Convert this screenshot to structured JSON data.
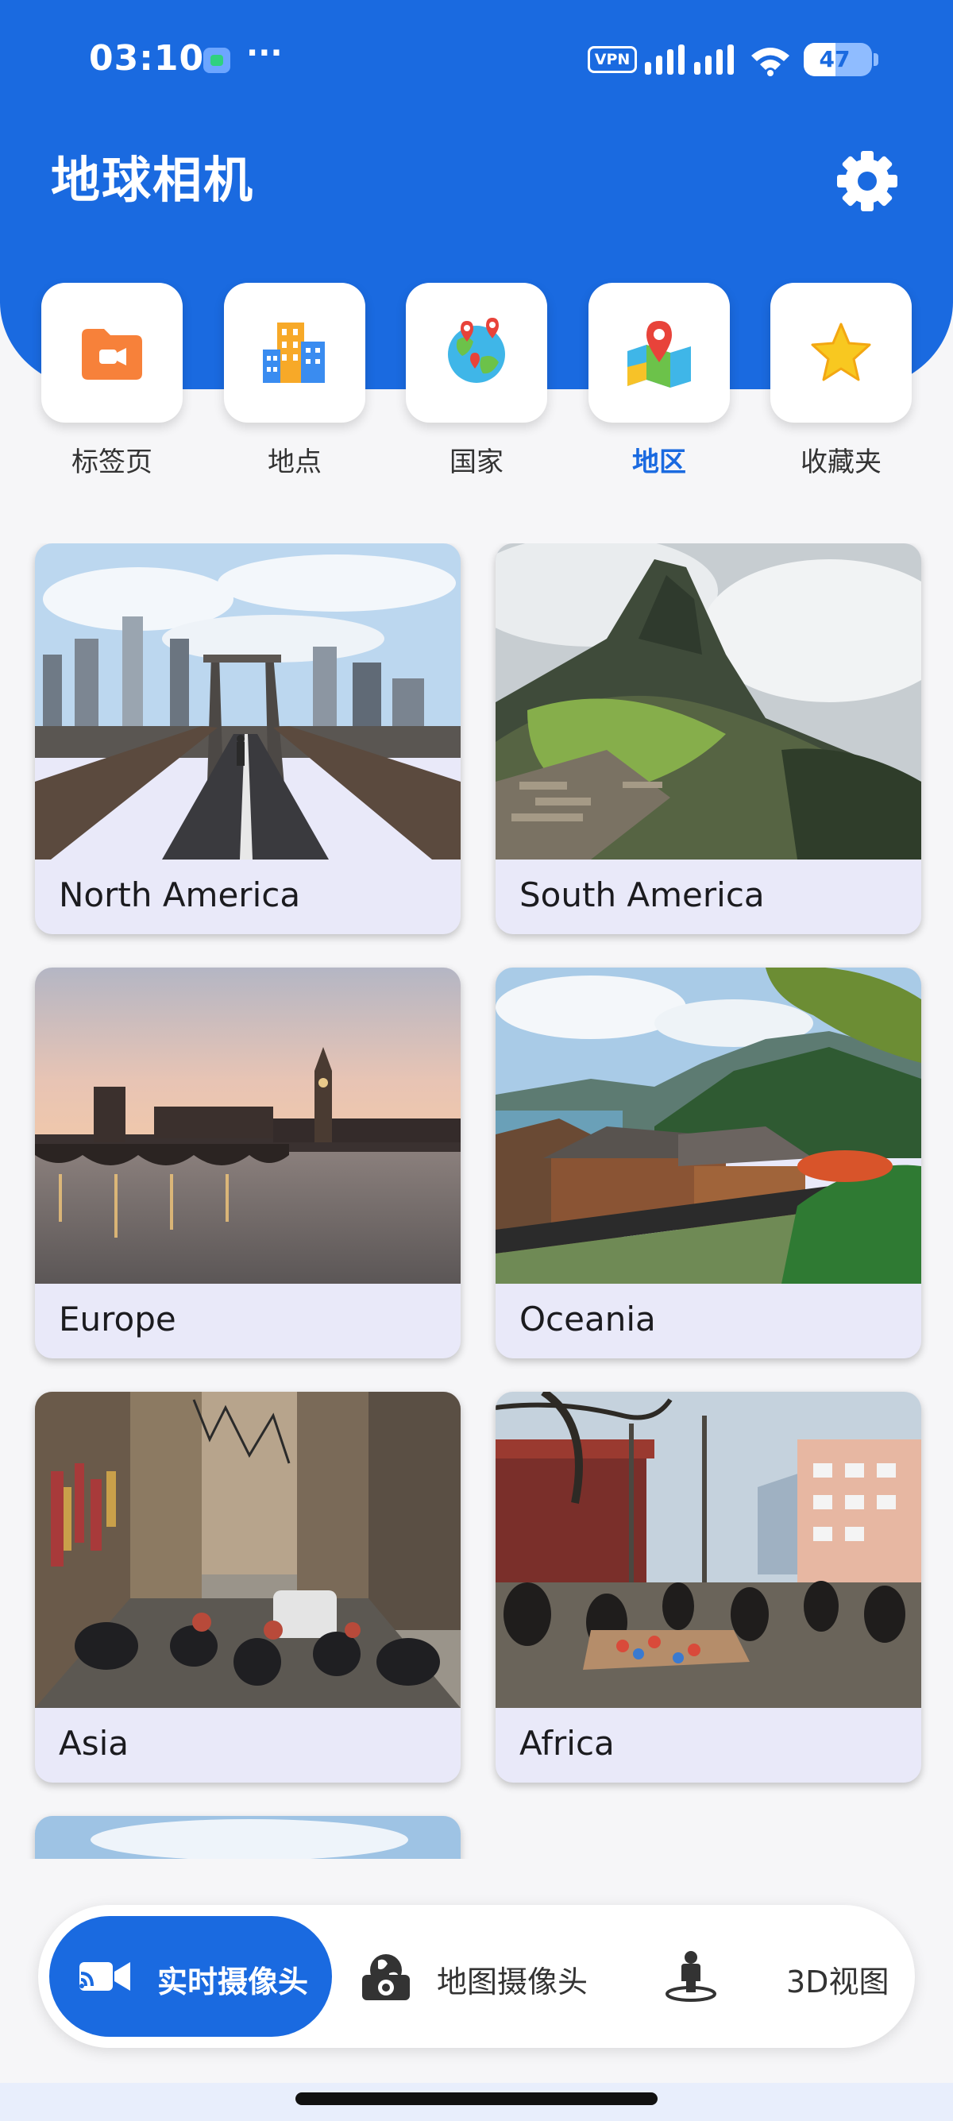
{
  "status_bar": {
    "time": "03:10",
    "dots": "···",
    "vpn": "VPN",
    "battery_level": "47",
    "battery_fraction": 0.47
  },
  "header": {
    "title": "地球相机",
    "settings_icon": "gear-icon"
  },
  "categories": [
    {
      "label": "标签页",
      "icon": "tag-folder-icon",
      "active": false
    },
    {
      "label": "地点",
      "icon": "buildings-icon",
      "active": false
    },
    {
      "label": "国家",
      "icon": "globe-pins-icon",
      "active": false
    },
    {
      "label": "地区",
      "icon": "map-pin-icon",
      "active": true
    },
    {
      "label": "收藏夹",
      "icon": "star-icon",
      "active": false
    }
  ],
  "regions": [
    {
      "name": "North America"
    },
    {
      "name": "South America"
    },
    {
      "name": "Europe"
    },
    {
      "name": "Oceania"
    },
    {
      "name": "Asia"
    },
    {
      "name": "Africa"
    }
  ],
  "bottom_nav": [
    {
      "label": "实时摄像头",
      "icon": "video-camera-icon",
      "active": true
    },
    {
      "label": "地图摄像头",
      "icon": "globe-camera-icon",
      "active": false
    },
    {
      "label": "3D视图",
      "icon": "street-view-person-icon",
      "active": false
    }
  ],
  "colors": {
    "primary": "#1a6ae0",
    "card_caption_bg": "#e9e9f9",
    "page_bg": "#f6f6f8"
  }
}
